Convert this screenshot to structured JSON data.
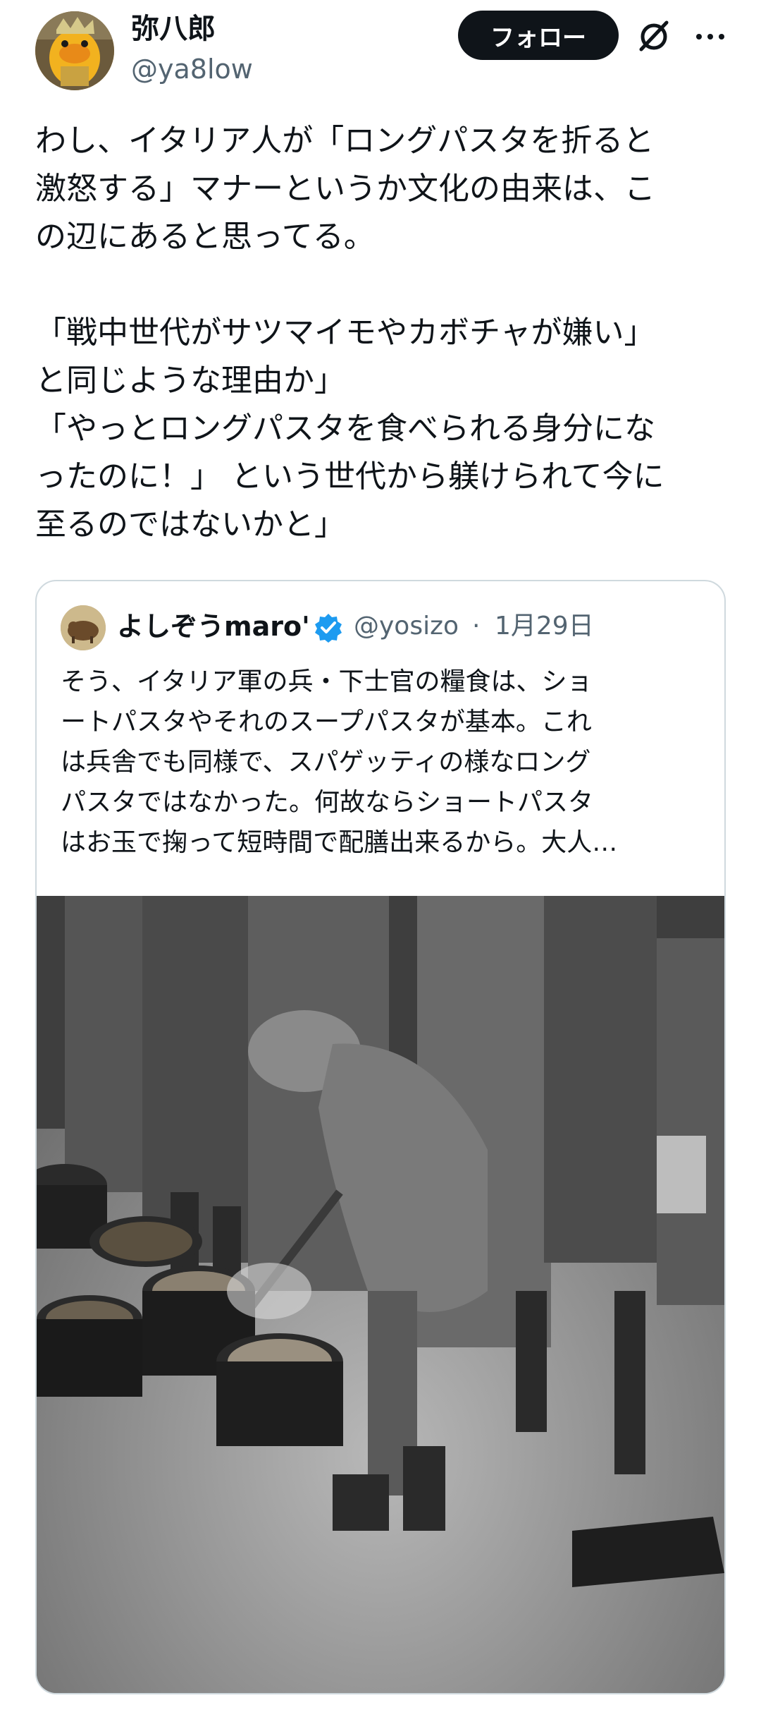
{
  "author": {
    "display_name": "弥八郎",
    "handle": "@ya8low"
  },
  "actions": {
    "follow_label": "フォロー",
    "grok_icon": "grok-slash-icon",
    "more_icon": "more-dots-icon"
  },
  "tweet": {
    "paragraph_1": "わし、イタリア人が「ロングパスタを折ると\n激怒する」マナーというか文化の由来は、こ\nの辺にあると思ってる。",
    "paragraph_2": "「戦中世代がサツマイモやカボチャが嫌い」\nと同じような理由か」\n「やっとロングパスタを食べられる身分にな\nったのに！」 という世代から躾けられて今に\n至るのではないかと」"
  },
  "quote": {
    "display_name": "よしぞうmaro'",
    "handle": "@yosizo",
    "separator": "·",
    "date": "1月29日",
    "text": "そう、イタリア軍の兵・下士官の糧食は、ショ\nートパスタやそれのスープパスタが基本。これ\nは兵舎でも同様で、スパゲッティの様なロング\nパスタではなかった。何故ならショートパスタ\nはお玉で掬って短時間で配膳出来るから。大人…",
    "verified_color": "#1d9bf0",
    "photo_icon": "black-and-white-photo-soldiers-serving-food"
  },
  "colors": {
    "text_primary": "#0f1419",
    "text_secondary": "#536471",
    "follow_bg": "#0f1419",
    "card_border": "#cfd9de",
    "verified": "#1d9bf0"
  }
}
